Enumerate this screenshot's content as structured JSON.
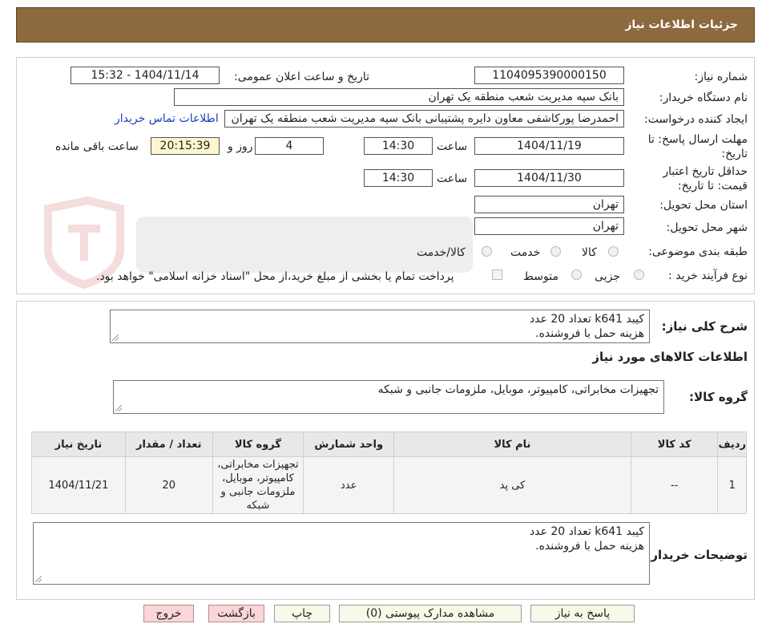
{
  "header": {
    "title": "جزئیات اطلاعات نیاز"
  },
  "form": {
    "need_number_label": "شماره نیاز:",
    "need_number": "1104095390000150",
    "announce_label": "تاریخ و ساعت اعلان عمومی:",
    "announce_value": "1404/11/14 - 15:32",
    "buyer_label": "نام دستگاه خریدار:",
    "buyer_value": "بانک سپه مدیریت شعب منطقه یک تهران",
    "creator_label": "ایجاد کننده درخواست:",
    "creator_value": "احمدرضا پورکاشفی معاون دایره پشتیبانی بانک سپه مدیریت شعب منطقه یک تهران",
    "contact_link": "اطلاعات تماس خریدار",
    "deadline_label_1": "مهلت ارسال پاسخ: تا",
    "deadline_label_2": "تاریخ:",
    "deadline_date": "1404/11/19",
    "time_label": "ساعت",
    "deadline_time": "14:30",
    "days_value": "4",
    "days_label": "روز و",
    "remaining_time": "20:15:39",
    "remaining_label": "ساعت باقی مانده",
    "validity_label_1": "حداقل تاریخ اعتبار",
    "validity_label_2": "قیمت: تا تاریخ:",
    "validity_date": "1404/11/30",
    "validity_time": "14:30",
    "province_label": "استان محل تحویل:",
    "province_value": "تهران",
    "city_label": "شهر محل تحویل:",
    "city_value": "تهران",
    "category_label": "طبقه بندی موضوعی:",
    "category_options": [
      "کالا",
      "خدمت",
      "کالا/خدمت"
    ],
    "process_label": "نوع فرآیند خرید :",
    "process_options": [
      "جزیی",
      "متوسط"
    ],
    "payment_note": "پرداخت تمام یا بخشی از مبلغ خرید،از محل \"اسناد خزانه اسلامی\" خواهد بود."
  },
  "summary": {
    "label": "شرح کلی نیاز:",
    "line1": "کیبد k641 تعداد 20 عدد",
    "line2": "هزینه حمل با فروشنده."
  },
  "goods": {
    "section_title": "اطلاعات کالاهای مورد نیاز",
    "group_label": "گروه کالا:",
    "group_value": "تجهیزات مخابراتی، کامپیوتر، موبایل، ملزومات جانبی و شبکه"
  },
  "table": {
    "headers": [
      "ردیف",
      "کد کالا",
      "نام کالا",
      "واحد شمارش",
      "گروه کالا",
      "تعداد / مقدار",
      "تاریخ نیاز"
    ],
    "rows": [
      [
        "1",
        "--",
        "کی پد",
        "عدد",
        "تجهیزات مخابراتی، کامپیوتر، موبایل، ملزومات جانبی و شبکه",
        "20",
        "1404/11/21"
      ]
    ]
  },
  "buyer_notes": {
    "label": "توضیحات خریدار:",
    "line1": "کیبد k641 تعداد 20 عدد",
    "line2": "هزینه حمل با فروشنده."
  },
  "buttons": {
    "reply": "پاسخ به نیاز",
    "attachments": "مشاهده مدارک پیوستی (0)",
    "print": "چاپ",
    "back": "بازگشت",
    "exit": "خروج"
  },
  "colors": {
    "header_bg": "#8c6a3d",
    "link": "#1a3fb8",
    "remaining_bg": "#fbf6cf",
    "button_green": "#f5fbe8",
    "button_red": "#fbd5d8"
  }
}
